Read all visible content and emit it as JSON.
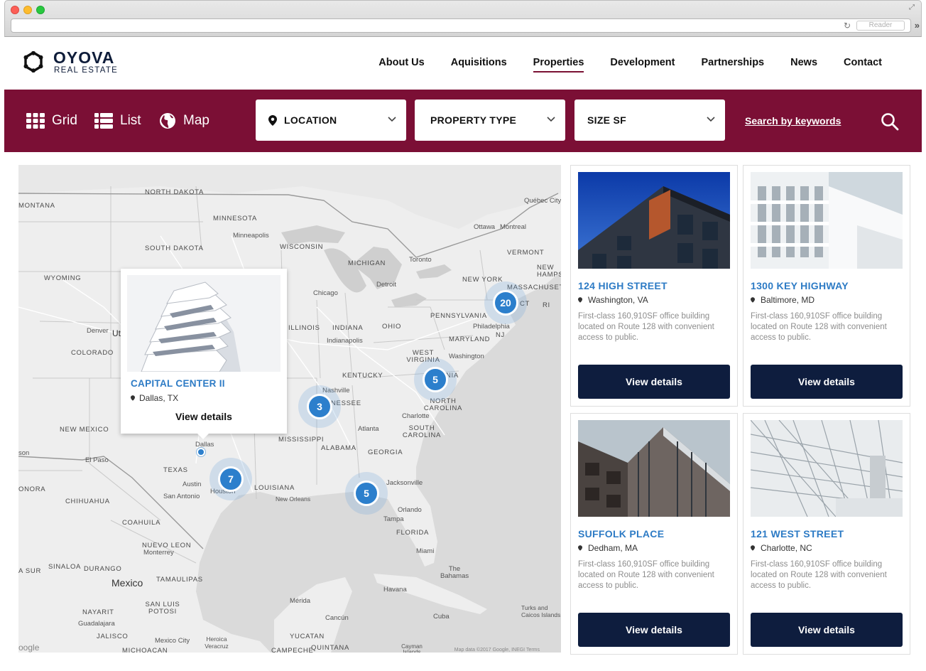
{
  "browser": {
    "reader_label": "Reader"
  },
  "brand": {
    "name": "OYOVA",
    "subtitle": "REAL ESTATE"
  },
  "nav": {
    "items": [
      {
        "label": "About Us",
        "active": false
      },
      {
        "label": "Aquisitions",
        "active": false
      },
      {
        "label": "Properties",
        "active": true
      },
      {
        "label": "Development",
        "active": false
      },
      {
        "label": "Partnerships",
        "active": false
      },
      {
        "label": "News",
        "active": false
      },
      {
        "label": "Contact",
        "active": false
      }
    ]
  },
  "filters": {
    "views": [
      {
        "label": "Grid",
        "icon": "grid-icon"
      },
      {
        "label": "List",
        "icon": "list-icon"
      },
      {
        "label": "Map",
        "icon": "globe-icon"
      }
    ],
    "location_label": "LOCATION",
    "property_type_label": "PROPERTY TYPE",
    "size_label": "SIZE SF",
    "keywords_link": "Search by keywords",
    "accent_color": "#7b0f35"
  },
  "map": {
    "labels": {
      "north_dakota": "NORTH DAKOTA",
      "montana": "MONTANA",
      "minnesota": "MINNESOTA",
      "minneapolis": "Minneapolis",
      "south_dakota": "SOUTH DAKOTA",
      "wisconsin": "WISCONSIN",
      "michigan": "MICHIGAN",
      "wyoming": "WYOMING",
      "toronto": "Toronto",
      "ottawa": "Ottawa",
      "montreal": "Montreal",
      "quebec_city": "Québec City",
      "vermont": "VERMONT",
      "new_hampshire": "NEW HAMPSHIRE",
      "new_york": "NEW YORK",
      "massachusetts": "MASSACHUSETTS",
      "ri": "RI",
      "ct": "CT",
      "detroit": "Detroit",
      "chicago": "Chicago",
      "pennsylvania": "PENNSYLVANIA",
      "philadelphia": "Philadelphia",
      "nj": "NJ",
      "denver": "Denver",
      "ut": "Ut",
      "illinois": "ILLINOIS",
      "indiana": "INDIANA",
      "ohio": "OHIO",
      "indianapolis": "Indianapolis",
      "maryland": "MARYLAND",
      "washington": "Washington",
      "colorado": "COLORADO",
      "west_virginia": "WEST VIRGINIA",
      "kentucky": "KENTUCKY",
      "nia": "NIA",
      "nashville": "Nashville",
      "nessee": "NESSEE",
      "north_carolina": "NORTH CAROLINA",
      "charlotte": "Charlotte",
      "new_mexico": "NEW MEXICO",
      "mississippi": "MISSISSIPPI",
      "atlanta": "Atlanta",
      "south_carolina": "SOUTH CAROLINA",
      "alabama": "ALABAMA",
      "georgia": "GEORGIA",
      "son": "son",
      "el_paso": "El Paso",
      "dallas": "Dallas",
      "texas": "TEXAS",
      "louisiana": "LOUISIANA",
      "jacksonville": "Jacksonville",
      "onora": "ONORA",
      "austin": "Austin",
      "houston": "Houston",
      "san_antonio": "San Antonio",
      "new_orleans": "New Orleans",
      "chihuahua": "CHIHUAHUA",
      "orlando": "Orlando",
      "tampa": "Tampa",
      "coahuila": "COAHUILA",
      "florida": "FLORIDA",
      "nuevo_leon": "NUEVO LEON",
      "monterrey": "Monterrey",
      "miami": "Miami",
      "sinaloa": "SINALOA",
      "durango": "DURANGO",
      "the_bahamas": "The Bahamas",
      "a_sur": "A SUR",
      "tamaulipas": "TAMAULIPAS",
      "mexico": "Mexico",
      "havana": "Havana",
      "san_luis_potosi": "SAN LUIS POTOSI",
      "nayarit": "NAYARIT",
      "merida": "Mérida",
      "cancun": "Cancún",
      "cuba": "Cuba",
      "guadalajara": "Guadalajara",
      "jalisco": "JALISCO",
      "yucatan": "YUCATAN",
      "turks_caicos": "Turks and Caicos Islands",
      "mexico_city": "Mexico City",
      "heroica_veracruz": "Heroica Veracruz",
      "michoacan": "MICHOACAN",
      "campeche": "CAMPECHE",
      "quintana": "QUINTANA",
      "cayman_islands": "Cayman Islands",
      "legal": "Map data ©2017 Google, INEGI  Terms",
      "google": "oogle"
    },
    "clusters": [
      {
        "count": "20"
      },
      {
        "count": "5"
      },
      {
        "count": "3"
      },
      {
        "count": "7"
      },
      {
        "count": "5"
      }
    ],
    "popup": {
      "title": "CAPITAL CENTER II",
      "location": "Dallas, TX",
      "button": "View details"
    }
  },
  "properties": [
    {
      "title": "124 HIGH STREET",
      "location": "Washington, VA",
      "description": "First-class 160,910SF office building located on Route 128 with convenient access to public.",
      "button": "View details"
    },
    {
      "title": "1300 KEY HIGHWAY",
      "location": "Baltimore, MD",
      "description": "First-class 160,910SF office building located on Route 128 with convenient access to public.",
      "button": "View details"
    },
    {
      "title": "SUFFOLK PLACE",
      "location": "Dedham, MA",
      "description": "First-class 160,910SF office building located on Route 128 with convenient access to public.",
      "button": "View details"
    },
    {
      "title": "121 WEST STREET",
      "location": "Charlotte, NC",
      "description": "First-class 160,910SF office building located on Route 128 with convenient access to public.",
      "button": "View details"
    }
  ],
  "colors": {
    "accent": "#7b0f35",
    "link_blue": "#2d7bc5",
    "button_navy": "#0e1d3e",
    "cluster_blue": "#2c7fcc"
  }
}
